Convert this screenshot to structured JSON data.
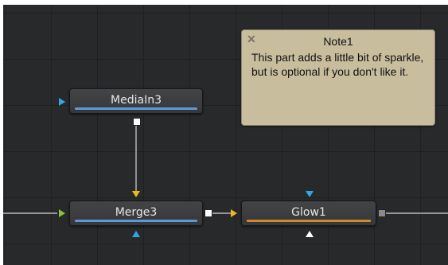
{
  "nodes": {
    "mediain": {
      "label": "MediaIn3",
      "color": "#5b9bd5"
    },
    "merge": {
      "label": "Merge3",
      "color": "#5b9bd5"
    },
    "glow": {
      "label": "Glow1",
      "color": "#d08a2b"
    }
  },
  "note": {
    "title": "Note1",
    "body": "This part adds a little bit of sparkle, but is optional if you don't like it."
  },
  "colors": {
    "foreground_input": "#8cbf3a",
    "background_input": "#e8b923",
    "mask_input": "#2fa7e0",
    "output": "#ffffff"
  }
}
